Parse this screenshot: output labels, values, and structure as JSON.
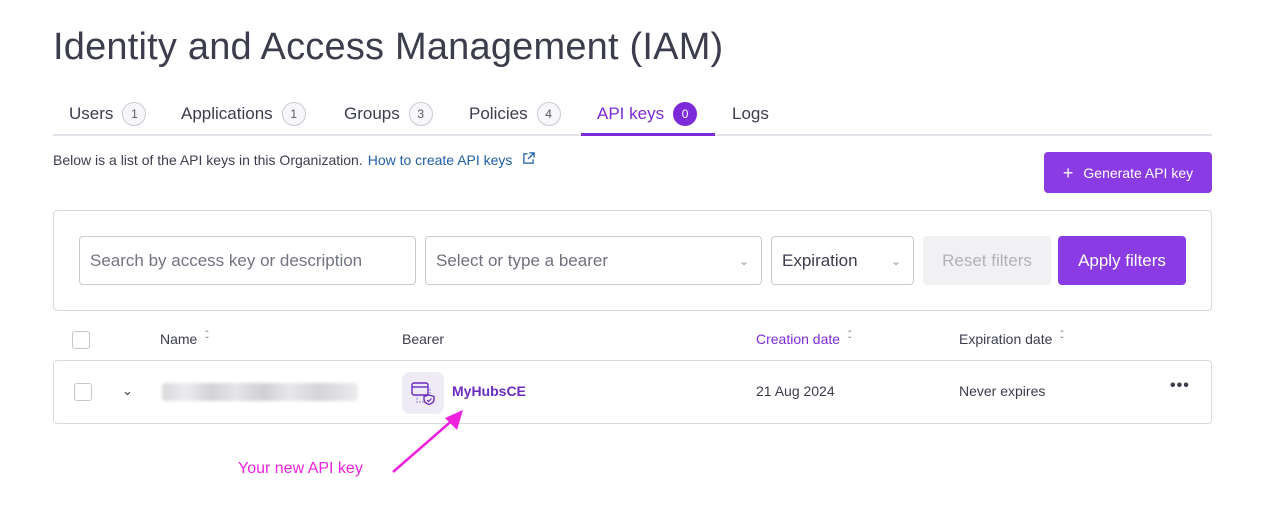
{
  "page": {
    "title": "Identity and Access Management (IAM)"
  },
  "tabs": [
    {
      "label": "Users",
      "count": "1"
    },
    {
      "label": "Applications",
      "count": "1"
    },
    {
      "label": "Groups",
      "count": "3"
    },
    {
      "label": "Policies",
      "count": "4"
    },
    {
      "label": "API keys",
      "count": "0",
      "active": true
    },
    {
      "label": "Logs"
    }
  ],
  "intro": {
    "text": "Below is a list of the API keys in this Organization.",
    "link": "How to create API keys",
    "link_icon": "external-link-icon"
  },
  "generate_button": {
    "icon": "plus-icon",
    "label": "Generate API key"
  },
  "filters": {
    "search_placeholder": "Search by access key or description",
    "bearer_placeholder": "Select or type a bearer",
    "expiration_label": "Expiration",
    "reset_label": "Reset filters",
    "apply_label": "Apply filters"
  },
  "table": {
    "columns": {
      "name": "Name",
      "bearer": "Bearer",
      "creation": "Creation date",
      "expiration": "Expiration date"
    },
    "rows": [
      {
        "name": "",
        "bearer_icon": "application-icon",
        "bearer": "MyHubsCE",
        "creation": "21 Aug 2024",
        "expiration": "Never expires",
        "actions": "•••"
      }
    ]
  },
  "annotation": {
    "text": "Your new API key"
  },
  "colors": {
    "accent": "#8a3be3",
    "annotation": "#ee22dd",
    "link": "#1f5fa8"
  }
}
